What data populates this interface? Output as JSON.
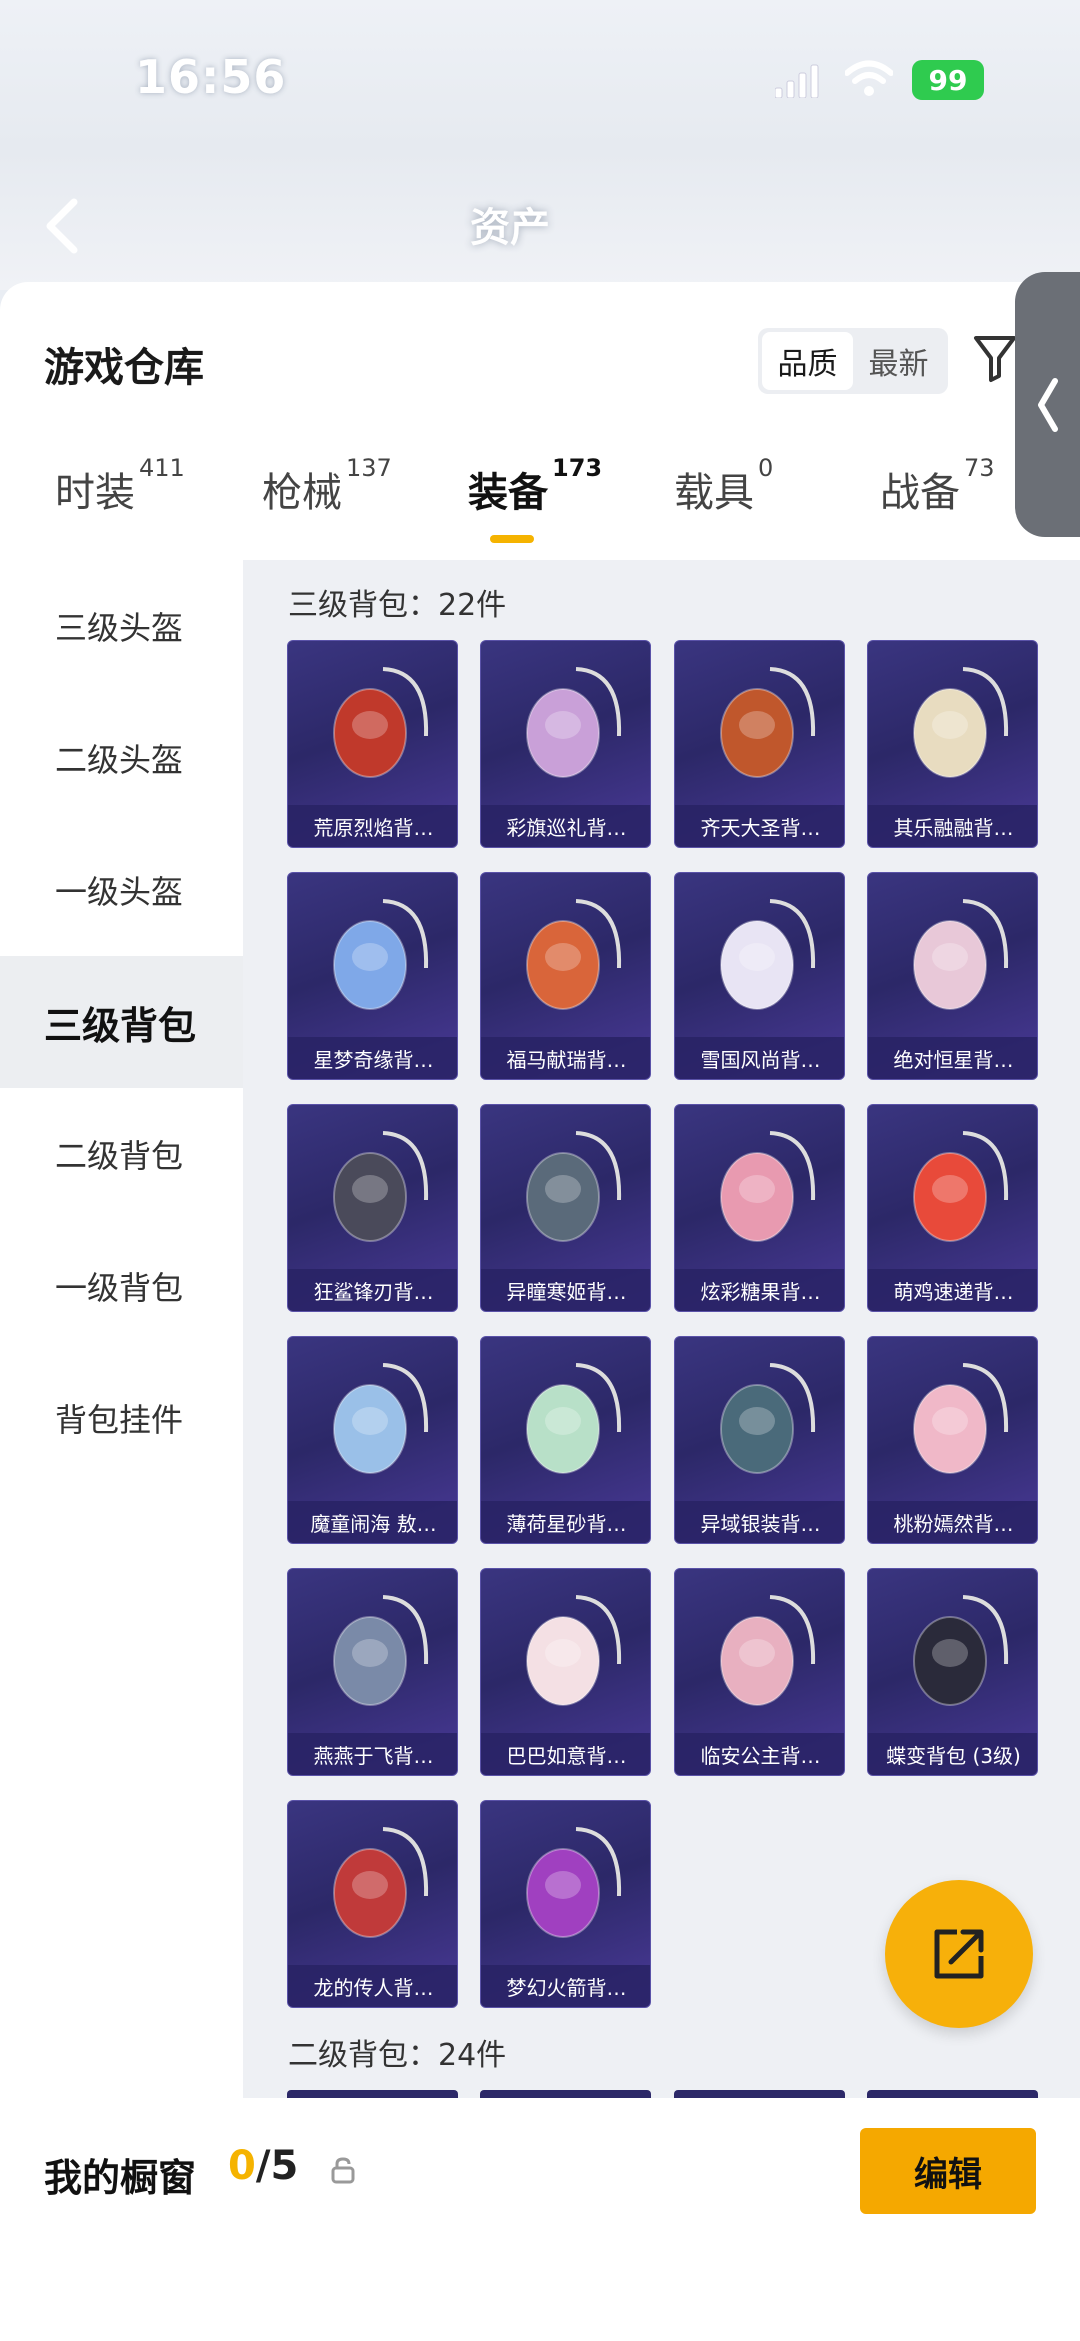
{
  "status": {
    "time": "16:56",
    "battery": "99"
  },
  "nav": {
    "title": "资产"
  },
  "header": {
    "title": "游戏仓库",
    "sort_options": [
      "品质",
      "最新"
    ],
    "sort_active": 0
  },
  "tabs": [
    {
      "label": "时装",
      "count": "411"
    },
    {
      "label": "枪械",
      "count": "137"
    },
    {
      "label": "装备",
      "count": "173"
    },
    {
      "label": "载具",
      "count": "0"
    },
    {
      "label": "战备",
      "count": "73"
    }
  ],
  "sidebar": {
    "items": [
      "三级头盔",
      "二级头盔",
      "一级头盔",
      "三级背包",
      "二级背包",
      "一级背包",
      "背包挂件"
    ],
    "active": 3
  },
  "sections": [
    {
      "title": "三级背包：22件",
      "items": [
        "荒原烈焰背…",
        "彩旗巡礼背…",
        "齐天大圣背…",
        "其乐融融背…",
        "星梦奇缘背…",
        "福马献瑞背…",
        "雪国风尚背…",
        "绝对恒星背…",
        "狂鲨锋刃背…",
        "异瞳寒姬背…",
        "炫彩糖果背…",
        "萌鸡速递背…",
        "魔童闹海 敖…",
        "薄荷星砂背…",
        "异域银装背…",
        "桃粉嫣然背…",
        "燕燕于飞背…",
        "巴巴如意背…",
        "临安公主背…",
        "蝶变背包 (3级)",
        "龙的传人背…",
        "梦幻火箭背…"
      ]
    },
    {
      "title": "二级背包：24件"
    }
  ],
  "bottom": {
    "label": "我的橱窗",
    "current": "0",
    "total": "/5",
    "edit_label": "编辑"
  },
  "colors": {
    "accent": "#f5b300",
    "card_bg": "#2c2868"
  }
}
